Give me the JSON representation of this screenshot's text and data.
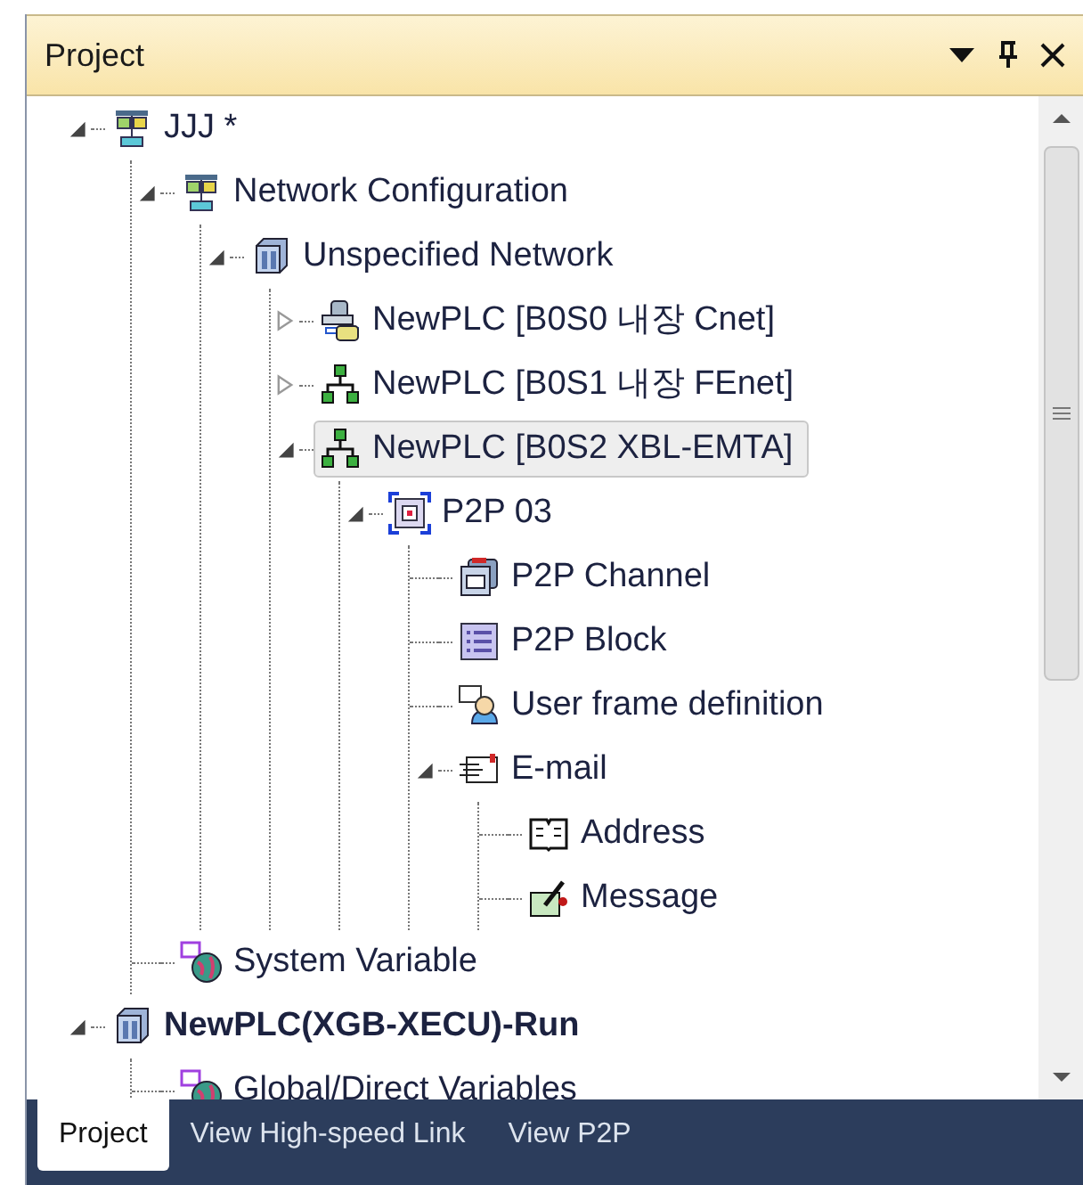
{
  "panel": {
    "title": "Project"
  },
  "tree": [
    {
      "label": "JJJ *",
      "kind": "project",
      "expanded": true,
      "selected": false,
      "bold": false,
      "children": [
        {
          "label": "Network Configuration",
          "kind": "project",
          "expanded": true,
          "selected": false,
          "bold": false,
          "children": [
            {
              "label": "Unspecified Network",
              "kind": "module",
              "expanded": true,
              "selected": false,
              "bold": false,
              "children": [
                {
                  "label": "NewPLC [B0S0 내장 Cnet]",
                  "kind": "serial",
                  "expanded": false,
                  "selected": false,
                  "bold": false
                },
                {
                  "label": "NewPLC [B0S1 내장 FEnet]",
                  "kind": "ethernet",
                  "expanded": false,
                  "selected": false,
                  "bold": false
                },
                {
                  "label": "NewPLC [B0S2 XBL-EMTA]",
                  "kind": "ethernet",
                  "expanded": true,
                  "selected": true,
                  "bold": false,
                  "children": [
                    {
                      "label": "P2P 03",
                      "kind": "p2p",
                      "expanded": true,
                      "selected": false,
                      "bold": false,
                      "children": [
                        {
                          "label": "P2P Channel",
                          "kind": "channel",
                          "selected": false,
                          "bold": false
                        },
                        {
                          "label": "P2P Block",
                          "kind": "block",
                          "selected": false,
                          "bold": false
                        },
                        {
                          "label": "User frame definition",
                          "kind": "userframe",
                          "selected": false,
                          "bold": false
                        },
                        {
                          "label": "E-mail",
                          "kind": "email",
                          "expanded": true,
                          "selected": false,
                          "bold": false,
                          "children": [
                            {
                              "label": "Address",
                              "kind": "address",
                              "selected": false,
                              "bold": false
                            },
                            {
                              "label": "Message",
                              "kind": "message",
                              "selected": false,
                              "bold": false
                            }
                          ]
                        }
                      ]
                    }
                  ]
                }
              ]
            }
          ]
        },
        {
          "label": "System Variable",
          "kind": "variable",
          "selected": false,
          "bold": false
        }
      ]
    },
    {
      "label": "NewPLC(XGB-XECU)-Run",
      "kind": "module",
      "expanded": true,
      "selected": false,
      "bold": true,
      "children": [
        {
          "label": "Global/Direct Variables",
          "kind": "variable",
          "selected": false,
          "bold": false
        }
      ]
    }
  ],
  "tabs": [
    {
      "label": "Project",
      "selected": true
    },
    {
      "label": "View High-speed Link",
      "selected": false
    },
    {
      "label": "View P2P",
      "selected": false
    }
  ]
}
